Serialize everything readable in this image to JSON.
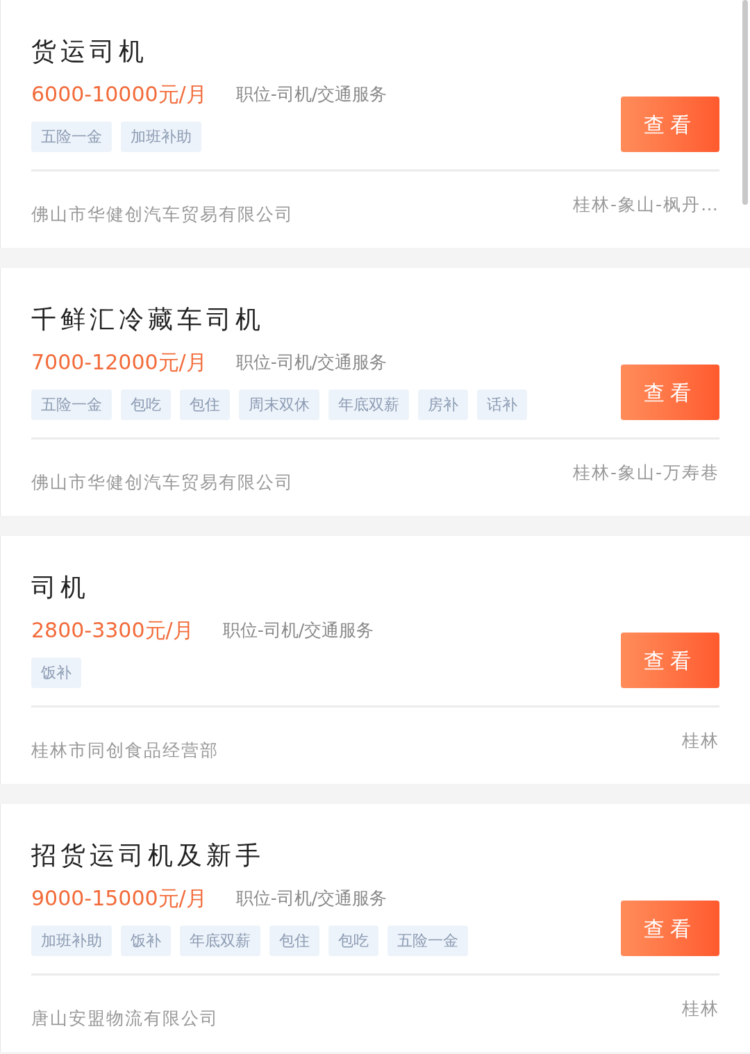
{
  "jobs": [
    {
      "title": "货运司机",
      "salary": "6000-10000元/月",
      "category": "职位-司机/交通服务",
      "tags": [
        "五险一金",
        "加班补助"
      ],
      "button": "查看",
      "company": "佛山市华健创汽车贸易有限公司",
      "location": "桂林-象山-枫丹…"
    },
    {
      "title": "千鲜汇冷藏车司机",
      "salary": "7000-12000元/月",
      "category": "职位-司机/交通服务",
      "tags": [
        "五险一金",
        "包吃",
        "包住",
        "周末双休",
        "年底双薪",
        "房补",
        "话补"
      ],
      "button": "查看",
      "company": "佛山市华健创汽车贸易有限公司",
      "location": "桂林-象山-万寿巷"
    },
    {
      "title": "司机",
      "salary": "2800-3300元/月",
      "category": "职位-司机/交通服务",
      "tags": [
        "饭补"
      ],
      "button": "查看",
      "company": "桂林市同创食品经营部",
      "location": "桂林"
    },
    {
      "title": "招货运司机及新手",
      "salary": "9000-15000元/月",
      "category": "职位-司机/交通服务",
      "tags": [
        "加班补助",
        "饭补",
        "年底双薪",
        "包住",
        "包吃",
        "五险一金"
      ],
      "button": "查看",
      "company": "唐山安盟物流有限公司",
      "location": "桂林"
    }
  ]
}
